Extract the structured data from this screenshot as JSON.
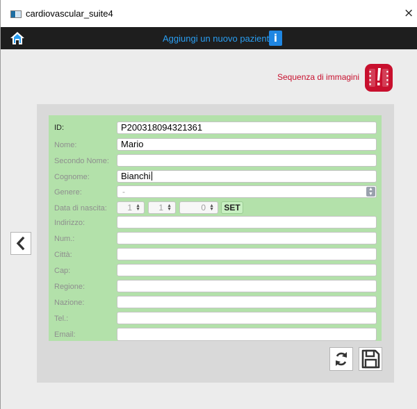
{
  "window": {
    "title": "cardiovascular_suite4",
    "close_symbol": "×",
    "app_icon": "app-window-icon"
  },
  "topbar": {
    "home_icon": "home-icon",
    "title": "Aggiungi un nuovo paziente",
    "info_label": "i"
  },
  "sequence": {
    "label": "Sequenza di immagini",
    "icon": "image-sequence-icon",
    "accent_color": "#c8102e"
  },
  "nav": {
    "back_icon": "chevron-left-icon"
  },
  "form": {
    "background": "#b3e1aa",
    "fields": {
      "id": {
        "label": "ID:",
        "value": "P200318094321361"
      },
      "nome": {
        "label": "Nome:",
        "value": "Mario"
      },
      "secondo_nome": {
        "label": "Secondo Nome:",
        "value": ""
      },
      "cognome": {
        "label": "Cognome:",
        "value": "Bianchi"
      },
      "genere": {
        "label": "Genere:",
        "value": "-"
      },
      "data_nascita": {
        "label": "Data di nascita:",
        "day": "1",
        "month": "1",
        "year": "0",
        "set_label": "SET"
      },
      "indirizzo": {
        "label": "Indirizzo:",
        "value": ""
      },
      "num": {
        "label": "Num.:",
        "value": ""
      },
      "citta": {
        "label": "Città:",
        "value": ""
      },
      "cap": {
        "label": "Cap:",
        "value": ""
      },
      "regione": {
        "label": "Regione:",
        "value": ""
      },
      "nazione": {
        "label": "Nazione:",
        "value": ""
      },
      "tel": {
        "label": "Tel.:",
        "value": ""
      },
      "email": {
        "label": "Email:",
        "value": ""
      }
    }
  },
  "toolbar": {
    "refresh_icon": "refresh-icon",
    "save_icon": "save-icon"
  }
}
